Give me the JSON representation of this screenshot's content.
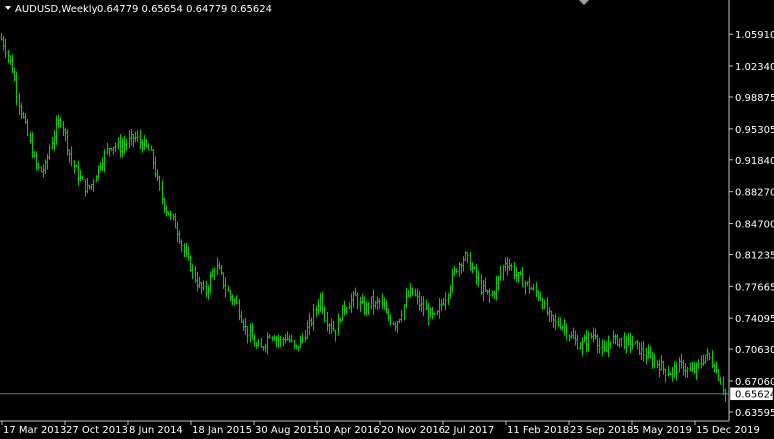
{
  "header": {
    "symbol_timeframe": "AUDUSD,Weekly",
    "ohlc": "0.64779 0.65654 0.64779 0.65624"
  },
  "current_price_label": "0.65624",
  "colors": {
    "background": "#000000",
    "bars": "#00d000",
    "axis": "#c0c0c0",
    "text": "#ffffff",
    "price_line": "#5f7f9f"
  },
  "icons": {
    "dropdown": "triangle-down-icon",
    "scroll_marker": "triangle-down-icon"
  },
  "chart_data": {
    "type": "ohlc",
    "symbol": "AUDUSD",
    "timeframe": "Weekly",
    "last_price": 0.65624,
    "ylim": [
      0.6325,
      1.075
    ],
    "y_ticks": [
      "1.05910",
      "1.02340",
      "0.98875",
      "0.95305",
      "0.91840",
      "0.88270",
      "0.84700",
      "0.81235",
      "0.77665",
      "0.74095",
      "0.70630",
      "0.67060",
      "0.63595"
    ],
    "x_ticks": [
      "17 Mar 2013",
      "27 Oct 2013",
      "8 Jun 2014",
      "18 Jan 2015",
      "30 Aug 2015",
      "10 Apr 2016",
      "20 Nov 2016",
      "2 Jul 2017",
      "11 Feb 2018",
      "23 Sep 2018",
      "5 May 2019",
      "15 Dec 2019"
    ],
    "close_path": [
      [
        0,
        1.055
      ],
      [
        5,
        1.045
      ],
      [
        12,
        1.02
      ],
      [
        18,
        0.985
      ],
      [
        24,
        0.96
      ],
      [
        30,
        0.935
      ],
      [
        35,
        0.915
      ],
      [
        40,
        0.905
      ],
      [
        45,
        0.91
      ],
      [
        50,
        0.935
      ],
      [
        55,
        0.95
      ],
      [
        60,
        0.965
      ],
      [
        64,
        0.95
      ],
      [
        68,
        0.93
      ],
      [
        72,
        0.915
      ],
      [
        76,
        0.905
      ],
      [
        81,
        0.895
      ],
      [
        86,
        0.885
      ],
      [
        91,
        0.89
      ],
      [
        96,
        0.905
      ],
      [
        100,
        0.915
      ],
      [
        105,
        0.925
      ],
      [
        110,
        0.935
      ],
      [
        115,
        0.935
      ],
      [
        120,
        0.932
      ],
      [
        125,
        0.937
      ],
      [
        130,
        0.94
      ],
      [
        134,
        0.944
      ],
      [
        138,
        0.94
      ],
      [
        143,
        0.935
      ],
      [
        148,
        0.93
      ],
      [
        152,
        0.92
      ],
      [
        156,
        0.9
      ],
      [
        160,
        0.88
      ],
      [
        165,
        0.865
      ],
      [
        170,
        0.855
      ],
      [
        175,
        0.845
      ],
      [
        180,
        0.83
      ],
      [
        185,
        0.81
      ],
      [
        190,
        0.8
      ],
      [
        195,
        0.785
      ],
      [
        200,
        0.775
      ],
      [
        205,
        0.77
      ],
      [
        210,
        0.785
      ],
      [
        215,
        0.8
      ],
      [
        220,
        0.79
      ],
      [
        225,
        0.775
      ],
      [
        230,
        0.765
      ],
      [
        235,
        0.76
      ],
      [
        240,
        0.745
      ],
      [
        245,
        0.73
      ],
      [
        250,
        0.72
      ],
      [
        255,
        0.71
      ],
      [
        260,
        0.705
      ],
      [
        265,
        0.715
      ],
      [
        270,
        0.725
      ],
      [
        275,
        0.72
      ],
      [
        280,
        0.715
      ],
      [
        285,
        0.72
      ],
      [
        290,
        0.715
      ],
      [
        295,
        0.705
      ],
      [
        300,
        0.715
      ],
      [
        305,
        0.725
      ],
      [
        310,
        0.735
      ],
      [
        315,
        0.75
      ],
      [
        320,
        0.765
      ],
      [
        325,
        0.74
      ],
      [
        330,
        0.735
      ],
      [
        335,
        0.725
      ],
      [
        340,
        0.745
      ],
      [
        345,
        0.755
      ],
      [
        350,
        0.76
      ],
      [
        355,
        0.765
      ],
      [
        360,
        0.755
      ],
      [
        365,
        0.75
      ],
      [
        370,
        0.76
      ],
      [
        375,
        0.755
      ],
      [
        380,
        0.76
      ],
      [
        385,
        0.745
      ],
      [
        390,
        0.74
      ],
      [
        395,
        0.735
      ],
      [
        400,
        0.745
      ],
      [
        405,
        0.76
      ],
      [
        410,
        0.77
      ],
      [
        415,
        0.765
      ],
      [
        420,
        0.755
      ],
      [
        425,
        0.75
      ],
      [
        430,
        0.745
      ],
      [
        435,
        0.74
      ],
      [
        440,
        0.755
      ],
      [
        445,
        0.765
      ],
      [
        450,
        0.78
      ],
      [
        455,
        0.795
      ],
      [
        460,
        0.805
      ],
      [
        465,
        0.81
      ],
      [
        470,
        0.8
      ],
      [
        475,
        0.79
      ],
      [
        480,
        0.775
      ],
      [
        485,
        0.77
      ],
      [
        490,
        0.765
      ],
      [
        495,
        0.775
      ],
      [
        500,
        0.79
      ],
      [
        505,
        0.805
      ],
      [
        510,
        0.8
      ],
      [
        515,
        0.79
      ],
      [
        520,
        0.785
      ],
      [
        525,
        0.78
      ],
      [
        530,
        0.775
      ],
      [
        535,
        0.77
      ],
      [
        540,
        0.765
      ],
      [
        545,
        0.75
      ],
      [
        550,
        0.74
      ],
      [
        555,
        0.735
      ],
      [
        560,
        0.735
      ],
      [
        565,
        0.73
      ],
      [
        570,
        0.72
      ],
      [
        575,
        0.715
      ],
      [
        580,
        0.71
      ],
      [
        585,
        0.715
      ],
      [
        590,
        0.72
      ],
      [
        595,
        0.725
      ],
      [
        600,
        0.705
      ],
      [
        605,
        0.7
      ],
      [
        610,
        0.72
      ],
      [
        615,
        0.715
      ],
      [
        620,
        0.718
      ],
      [
        625,
        0.712
      ],
      [
        630,
        0.715
      ],
      [
        635,
        0.71
      ],
      [
        640,
        0.705
      ],
      [
        645,
        0.7
      ],
      [
        650,
        0.695
      ],
      [
        655,
        0.692
      ],
      [
        660,
        0.688
      ],
      [
        665,
        0.682
      ],
      [
        670,
        0.68
      ],
      [
        675,
        0.684
      ],
      [
        680,
        0.688
      ],
      [
        685,
        0.685
      ],
      [
        690,
        0.68
      ],
      [
        695,
        0.683
      ],
      [
        700,
        0.69
      ],
      [
        705,
        0.7
      ],
      [
        710,
        0.695
      ],
      [
        715,
        0.685
      ],
      [
        720,
        0.672
      ],
      [
        725,
        0.656
      ]
    ]
  }
}
